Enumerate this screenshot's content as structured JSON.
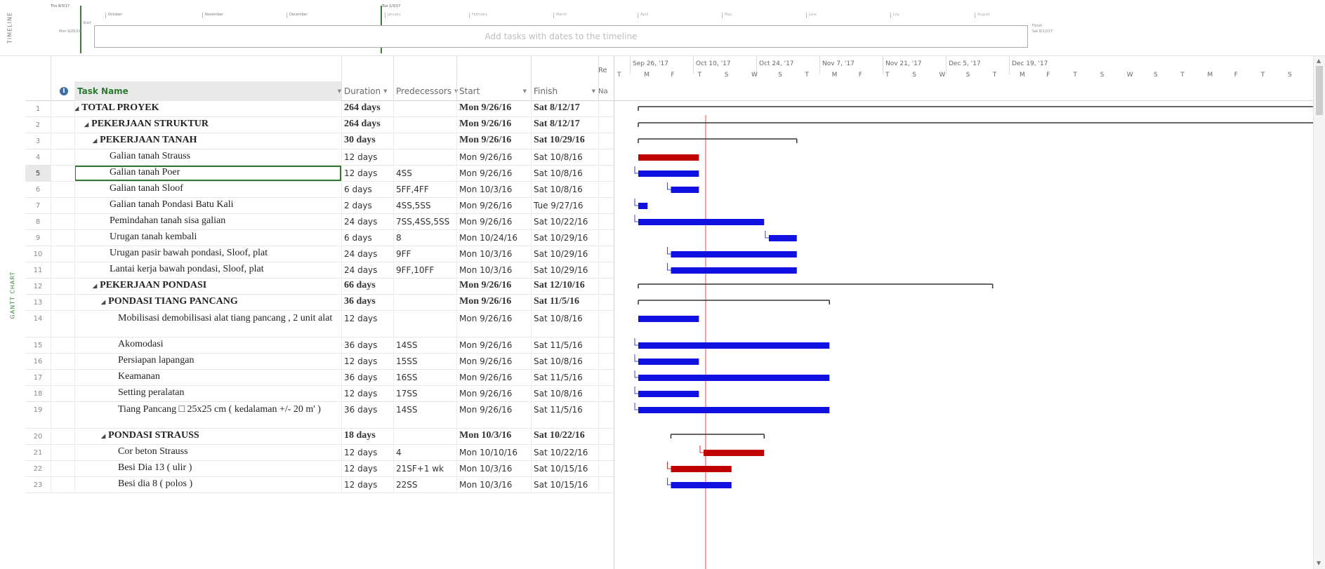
{
  "timeline": {
    "vertical_label": "TIMELINE",
    "today_label": "Thu 8/3/17",
    "today2_label": "Tue 1/3/17",
    "start_label": "Start",
    "start_date": "Mon 9/26/16",
    "finish_label": "Finish",
    "finish_date": "Sat 8/12/17",
    "months": [
      "October",
      "November",
      "December",
      "January",
      "February",
      "March",
      "April",
      "May",
      "June",
      "July",
      "August"
    ],
    "placeholder": "Add tasks with dates to the timeline"
  },
  "gantt_side_label": "GANTT CHART",
  "columns": {
    "indicators_icon": "info-icon",
    "task_name": "Task Name",
    "duration": "Duration",
    "predecessors": "Predecessors",
    "start": "Start",
    "finish": "Finish",
    "resource_names_top": "Re",
    "resource_names_bottom": "Na"
  },
  "chart_header": {
    "weeks": [
      "Sep 26, '17",
      "Oct 10, '17",
      "Oct 24, '17",
      "Nov 7, '17",
      "Nov 21, '17",
      "Dec 5, '17",
      "Dec 19, '17"
    ],
    "days": [
      "T",
      "M",
      "F",
      "T",
      "S",
      "W",
      "S",
      "T",
      "M",
      "F",
      "T",
      "S",
      "W",
      "S",
      "T",
      "M",
      "F",
      "T",
      "S",
      "W",
      "S",
      "T",
      "M",
      "F",
      "T",
      "S"
    ]
  },
  "tasks": [
    {
      "id": "1",
      "name": "TOTAL PROYEK",
      "indent": 0,
      "summary": true,
      "duration": "264 days",
      "pred": "",
      "start": "Mon 9/26/16",
      "finish": "Sat 8/12/17",
      "s": 0,
      "d": 264,
      "critical": false
    },
    {
      "id": "2",
      "name": "PEKERJAAN STRUKTUR",
      "indent": 1,
      "summary": true,
      "duration": "264 days",
      "pred": "",
      "start": "Mon 9/26/16",
      "finish": "Sat 8/12/17",
      "s": 0,
      "d": 264,
      "critical": false
    },
    {
      "id": "3",
      "name": "PEKERJAAN TANAH",
      "indent": 2,
      "summary": true,
      "duration": "30 days",
      "pred": "",
      "start": "Mon 9/26/16",
      "finish": "Sat 10/29/16",
      "s": 0,
      "d": 34,
      "critical": false
    },
    {
      "id": "4",
      "name": "Galian tanah Strauss",
      "indent": 3,
      "summary": false,
      "duration": "12 days",
      "pred": "",
      "start": "Mon 9/26/16",
      "finish": "Sat 10/8/16",
      "s": 0,
      "d": 13,
      "critical": true
    },
    {
      "id": "5",
      "name": "Galian tanah Poer",
      "indent": 3,
      "summary": false,
      "duration": "12 days",
      "pred": "4SS",
      "start": "Mon 9/26/16",
      "finish": "Sat 10/8/16",
      "s": 0,
      "d": 13,
      "critical": false,
      "selected": true
    },
    {
      "id": "6",
      "name": "Galian tanah Sloof",
      "indent": 3,
      "summary": false,
      "duration": "6 days",
      "pred": "5FF,4FF",
      "start": "Mon 10/3/16",
      "finish": "Sat 10/8/16",
      "s": 7,
      "d": 6,
      "critical": false
    },
    {
      "id": "7",
      "name": "Galian tanah Pondasi Batu Kali",
      "indent": 3,
      "summary": false,
      "duration": "2 days",
      "pred": "4SS,5SS",
      "start": "Mon 9/26/16",
      "finish": "Tue 9/27/16",
      "s": 0,
      "d": 2,
      "critical": false
    },
    {
      "id": "8",
      "name": "Pemindahan tanah sisa galian",
      "indent": 3,
      "summary": false,
      "duration": "24 days",
      "pred": "7SS,4SS,5SS",
      "start": "Mon 9/26/16",
      "finish": "Sat 10/22/16",
      "s": 0,
      "d": 27,
      "critical": false
    },
    {
      "id": "9",
      "name": "Urugan tanah kembali",
      "indent": 3,
      "summary": false,
      "duration": "6 days",
      "pred": "8",
      "start": "Mon 10/24/16",
      "finish": "Sat 10/29/16",
      "s": 28,
      "d": 6,
      "critical": false
    },
    {
      "id": "10",
      "name": "Urugan pasir bawah pondasi, Sloof, plat",
      "indent": 3,
      "summary": false,
      "duration": "24 days",
      "pred": "9FF",
      "start": "Mon 10/3/16",
      "finish": "Sat 10/29/16",
      "s": 7,
      "d": 27,
      "critical": false
    },
    {
      "id": "11",
      "name": "Lantai kerja bawah pondasi, Sloof, plat",
      "indent": 3,
      "summary": false,
      "duration": "24 days",
      "pred": "9FF,10FF",
      "start": "Mon 10/3/16",
      "finish": "Sat 10/29/16",
      "s": 7,
      "d": 27,
      "critical": false
    },
    {
      "id": "12",
      "name": "PEKERJAAN PONDASI",
      "indent": 2,
      "summary": true,
      "duration": "66 days",
      "pred": "",
      "start": "Mon 9/26/16",
      "finish": "Sat 12/10/16",
      "s": 0,
      "d": 76,
      "critical": false
    },
    {
      "id": "13",
      "name": "PONDASI TIANG PANCANG",
      "indent": 3,
      "summary": true,
      "duration": "36 days",
      "pred": "",
      "start": "Mon 9/26/16",
      "finish": "Sat 11/5/16",
      "s": 0,
      "d": 41,
      "critical": false
    },
    {
      "id": "14",
      "name": "Mobilisasi demobilisasi alat tiang pancang , 2 unit alat",
      "indent": 4,
      "summary": false,
      "tall": true,
      "duration": "12 days",
      "pred": "",
      "start": "Mon 9/26/16",
      "finish": "Sat 10/8/16",
      "s": 0,
      "d": 13,
      "critical": false
    },
    {
      "id": "15",
      "name": "Akomodasi",
      "indent": 4,
      "summary": false,
      "duration": "36 days",
      "pred": "14SS",
      "start": "Mon 9/26/16",
      "finish": "Sat 11/5/16",
      "s": 0,
      "d": 41,
      "critical": false
    },
    {
      "id": "16",
      "name": "Persiapan lapangan",
      "indent": 4,
      "summary": false,
      "duration": "12 days",
      "pred": "15SS",
      "start": "Mon 9/26/16",
      "finish": "Sat 10/8/16",
      "s": 0,
      "d": 13,
      "critical": false
    },
    {
      "id": "17",
      "name": "Keamanan",
      "indent": 4,
      "summary": false,
      "duration": "36 days",
      "pred": "16SS",
      "start": "Mon 9/26/16",
      "finish": "Sat 11/5/16",
      "s": 0,
      "d": 41,
      "critical": false
    },
    {
      "id": "18",
      "name": "Setting peralatan",
      "indent": 4,
      "summary": false,
      "duration": "12 days",
      "pred": "17SS",
      "start": "Mon 9/26/16",
      "finish": "Sat 10/8/16",
      "s": 0,
      "d": 13,
      "critical": false
    },
    {
      "id": "19",
      "name": "Tiang Pancang □ 25x25 cm ( kedalaman +/- 20 m' )",
      "indent": 4,
      "summary": false,
      "tall": true,
      "duration": "36 days",
      "pred": "14SS",
      "start": "Mon 9/26/16",
      "finish": "Sat 11/5/16",
      "s": 0,
      "d": 41,
      "critical": false
    },
    {
      "id": "20",
      "name": "PONDASI STRAUSS",
      "indent": 3,
      "summary": true,
      "duration": "18 days",
      "pred": "",
      "start": "Mon 10/3/16",
      "finish": "Sat 10/22/16",
      "s": 7,
      "d": 20,
      "critical": false
    },
    {
      "id": "21",
      "name": "Cor beton Strauss",
      "indent": 4,
      "summary": false,
      "duration": "12 days",
      "pred": "4",
      "start": "Mon 10/10/16",
      "finish": "Sat 10/22/16",
      "s": 14,
      "d": 13,
      "critical": true
    },
    {
      "id": "22",
      "name": "Besi Dia 13 ( ulir )",
      "indent": 4,
      "summary": false,
      "duration": "12 days",
      "pred": "21SF+1 wk",
      "start": "Mon 10/3/16",
      "finish": "Sat 10/15/16",
      "s": 7,
      "d": 13,
      "critical": true
    },
    {
      "id": "23",
      "name": "Besi dia 8 ( polos )",
      "indent": 4,
      "summary": false,
      "duration": "12 days",
      "pred": "22SS",
      "start": "Mon 10/3/16",
      "finish": "Sat 10/15/16",
      "s": 7,
      "d": 13,
      "critical": false
    }
  ],
  "colors": {
    "normal_bar": "#1010e0",
    "critical_bar": "#c00000",
    "summary_bar": "#333333",
    "link_line": "#4040d0",
    "critical_link": "#e02020",
    "status_date_line": "#ff4040",
    "accent_green": "#2d7a2d"
  }
}
